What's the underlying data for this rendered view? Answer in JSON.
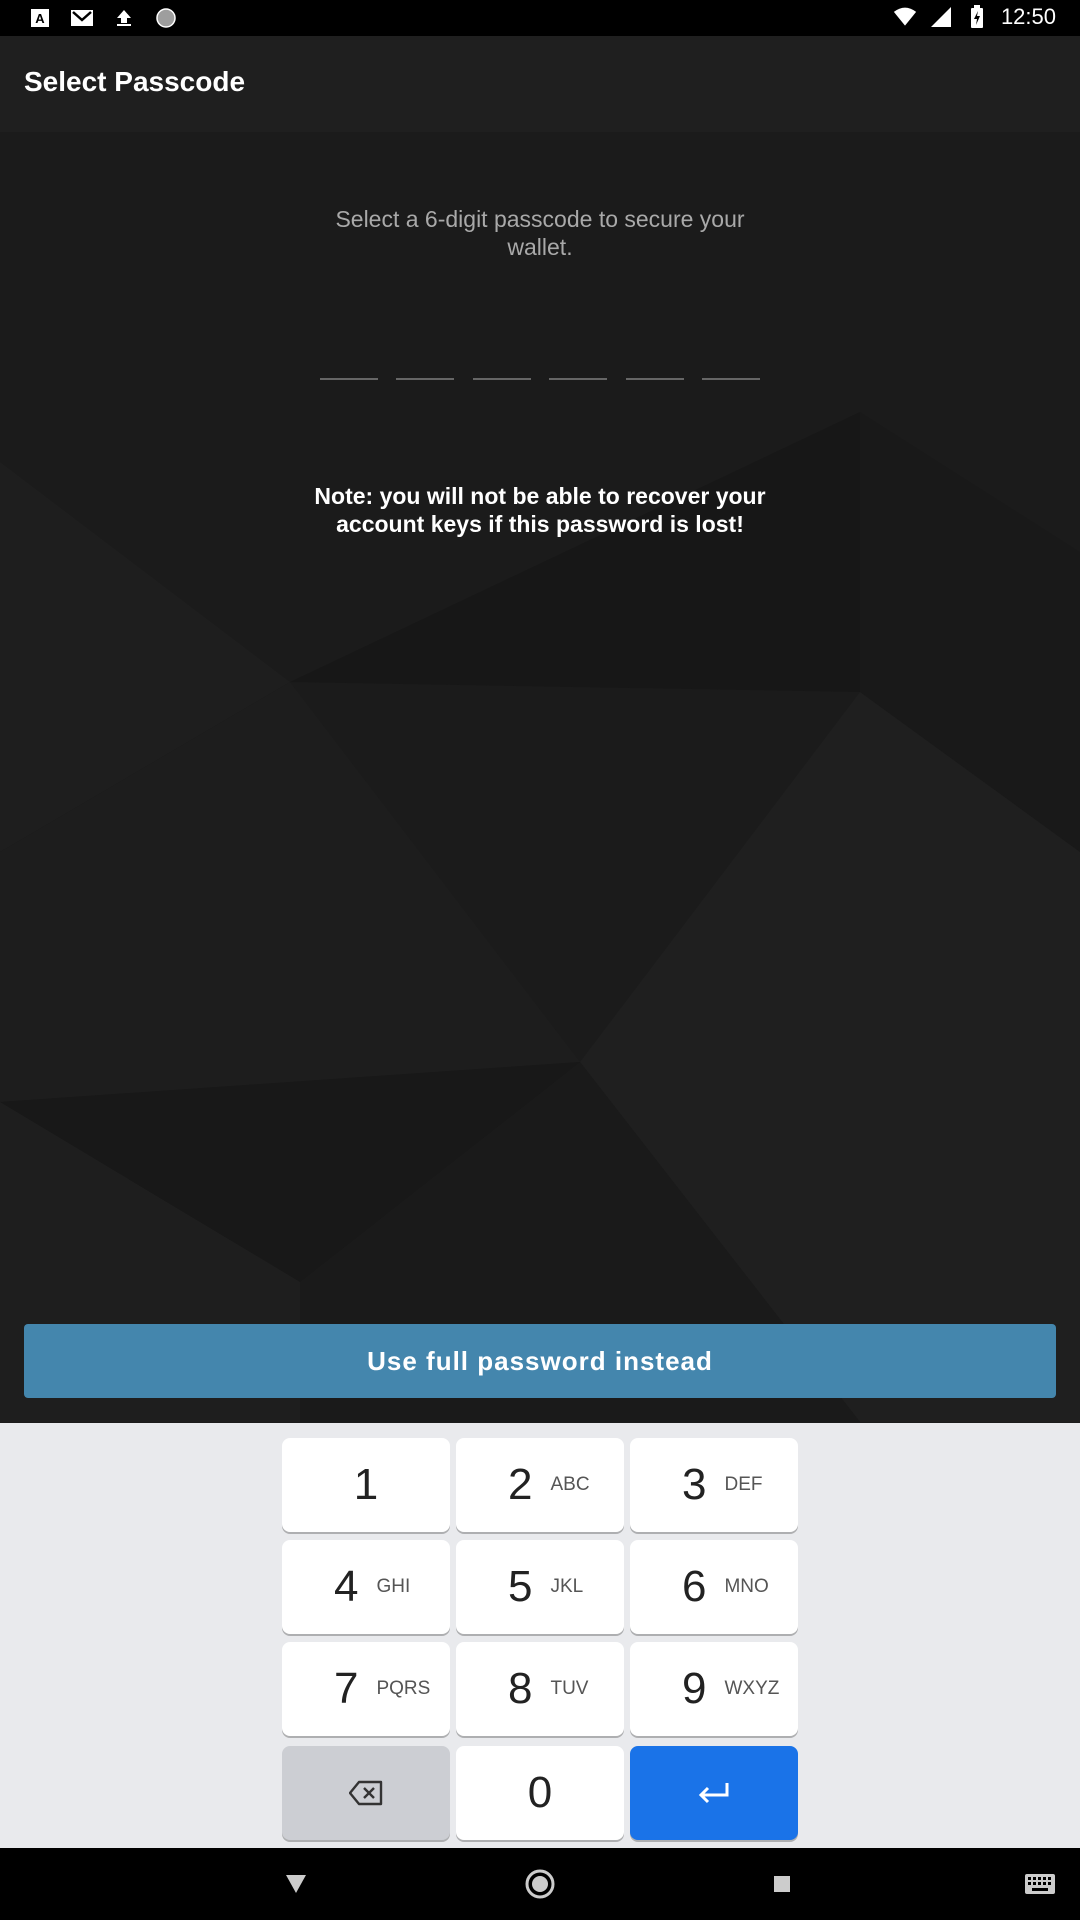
{
  "status_bar": {
    "time": "12:50",
    "left_icons": [
      "font-icon",
      "gmail-icon",
      "upload-icon",
      "circle-icon"
    ],
    "right_icons": [
      "wifi-icon",
      "signal-icon",
      "battery-icon"
    ]
  },
  "app_bar": {
    "title": "Select Passcode"
  },
  "main": {
    "instruction": "Select a 6-digit passcode to secure your wallet.",
    "passcode_length": 6,
    "note": "Note: you will not be able to recover your account keys if this password is lost!",
    "full_password_button": "Use full password instead"
  },
  "keyboard": {
    "keys": [
      {
        "digit": "1",
        "letters": ""
      },
      {
        "digit": "2",
        "letters": "ABC"
      },
      {
        "digit": "3",
        "letters": "DEF"
      },
      {
        "digit": "4",
        "letters": "GHI"
      },
      {
        "digit": "5",
        "letters": "JKL"
      },
      {
        "digit": "6",
        "letters": "MNO"
      },
      {
        "digit": "7",
        "letters": "PQRS"
      },
      {
        "digit": "8",
        "letters": "TUV"
      },
      {
        "digit": "9",
        "letters": "WXYZ"
      }
    ],
    "zero": "0",
    "backspace_icon": "backspace-icon",
    "enter_icon": "enter-icon"
  },
  "nav_bar": {
    "icons": [
      "back-icon",
      "home-icon",
      "recents-icon",
      "keyboard-icon"
    ]
  },
  "colors": {
    "accent_button": "#4486ad",
    "enter_key": "#1a73e8",
    "background": "#1b1b1b"
  }
}
